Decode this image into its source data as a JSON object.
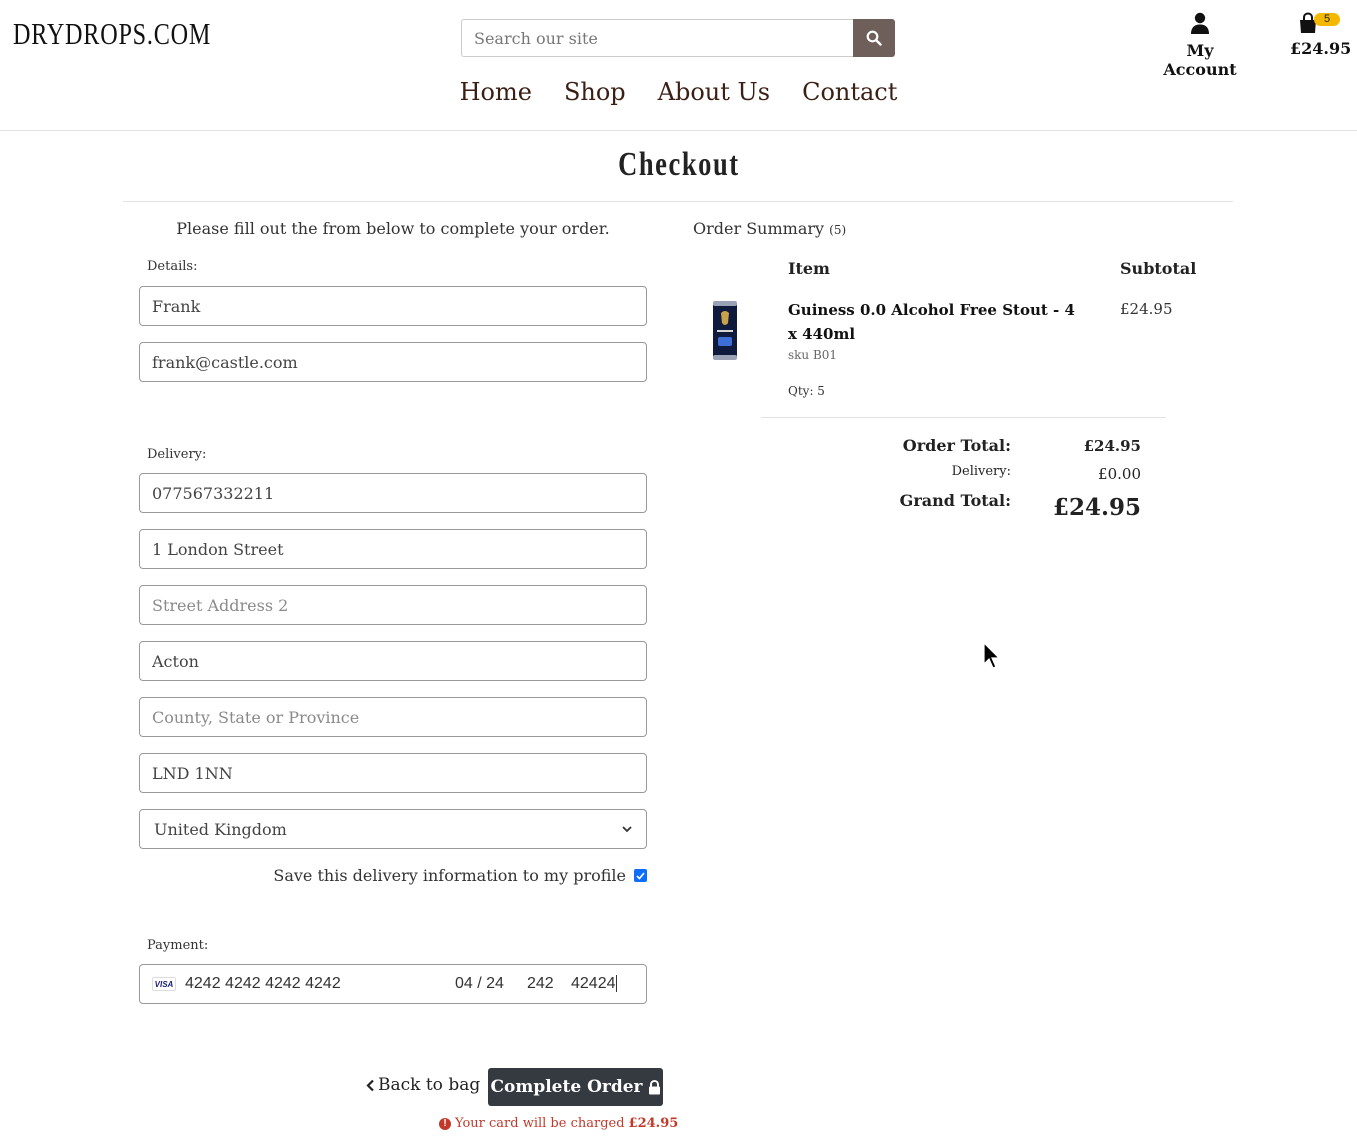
{
  "header": {
    "logo": "DRYDROPS.COM",
    "search_placeholder": "Search our site",
    "account_label": "My Account",
    "bag_count": "5",
    "bag_total": "£24.95"
  },
  "nav": {
    "items": [
      "Home",
      "Shop",
      "About Us",
      "Contact"
    ]
  },
  "page": {
    "title": "Checkout",
    "intro": "Please fill out the from below to complete your order."
  },
  "form": {
    "details_label": "Details:",
    "full_name": "Frank",
    "email": "frank@castle.com",
    "delivery_label": "Delivery:",
    "phone": "077567332211",
    "street1": "1 London Street",
    "street2_placeholder": "Street Address 2",
    "town": "Acton",
    "county_placeholder": "County, State or Province",
    "postcode": "LND 1NN",
    "country": "United Kingdom",
    "save_info_label": "Save this delivery information to my profile",
    "payment_label": "Payment:",
    "card": {
      "brand": "VISA",
      "number": "4242 4242 4242 4242",
      "expiry": "04 / 24",
      "cvc": "242",
      "zip": "42424"
    },
    "back_label": "Back to bag",
    "complete_label": "Complete Order",
    "charge_note": "Your card will be charged",
    "charge_amount": "£24.95"
  },
  "summary": {
    "title": "Order Summary",
    "count": "(5)",
    "col_item": "Item",
    "col_subtotal": "Subtotal",
    "product": {
      "name": "Guiness 0.0 Alcohol Free Stout - 4 x 440ml",
      "sku": "sku B01",
      "qty": "Qty: 5",
      "price": "£24.95"
    },
    "order_total_label": "Order Total:",
    "order_total": "£24.95",
    "delivery_label": "Delivery:",
    "delivery": "£0.00",
    "grand_total_label": "Grand Total:",
    "grand_total": "£24.95"
  },
  "colors": {
    "search_button": "#6f5f5b",
    "nav_text": "#3a1f14",
    "primary_button": "#343a40",
    "badge": "#f5b800",
    "alert": "#c0392b",
    "checkbox": "#0d6efd"
  }
}
